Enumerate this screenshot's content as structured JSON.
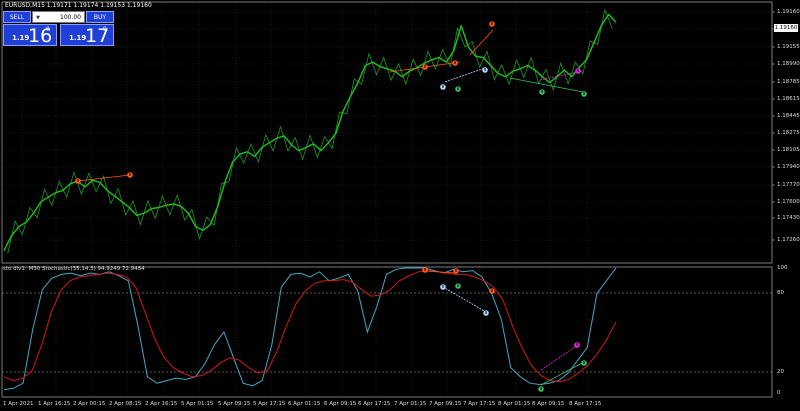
{
  "symbol_line": "EURUSD,M15  1.19171 1.19174 1.19153 1.19160",
  "trade_panel": {
    "sell_label": "SELL",
    "buy_label": "BUY",
    "lot_value": "100.00",
    "lot_arrow": "▼",
    "sell_price_small": "1.19",
    "sell_price_big": "16",
    "sell_price_sup": "0",
    "buy_price_small": "1.19",
    "buy_price_big": "17",
    "buy_price_sup": "9"
  },
  "indicator_title": "sto div1: M30 Stochastic(35,14,3) 94.9249 72.9484",
  "price_axis": [
    "1.19160",
    "1.19325",
    "1.19155",
    "1.18990",
    "1.18785",
    "1.18615",
    "1.18445",
    "1.18275",
    "1.18105",
    "1.17940",
    "1.17770",
    "1.17600",
    "1.17430",
    "1.17260"
  ],
  "current_price": "1.19160",
  "indicator_axis": [
    "100",
    "80",
    "20",
    "0"
  ],
  "time_axis": [
    "1 Apr 2021",
    "1 Apr 16:15",
    "2 Apr 00:15",
    "2 Apr 08:15",
    "2 Apr 16:15",
    "5 Apr 01:15",
    "5 Apr 09:15",
    "5 Apr 17:15",
    "6 Apr 01:15",
    "6 Apr 09:15",
    "6 Apr 17:15",
    "7 Apr 01:15",
    "7 Apr 09:15",
    "7 Apr 17:15",
    "8 Apr 01:15",
    "8 Apr 09:15",
    "8 Apr 17:15"
  ],
  "colors": {
    "background": "#000000",
    "grid": "#34343a",
    "frame": "#b0b0b0",
    "price_line": "#20c020",
    "main_line": "#43a8c8",
    "signal_line": "#d01818",
    "level_line": "#b0b0b0",
    "marker_orange": "#ff5a1a",
    "marker_green": "#3ac060",
    "marker_blue": "#b0d8ff",
    "marker_magenta": "#e028d8"
  },
  "chart_data": [
    {
      "type": "line",
      "series": [
        {
          "values": [
            1.1727,
            1.174,
            1.1748,
            1.1752,
            1.176,
            1.177,
            1.1774,
            1.1778,
            1.178,
            1.1786,
            1.1788,
            1.1783,
            1.1789,
            1.1787,
            1.178,
            1.1775,
            1.177,
            1.1765,
            1.1758,
            1.176,
            1.1764,
            1.1765,
            1.1767,
            1.1768,
            1.1766,
            1.176,
            1.1748,
            1.1745,
            1.175,
            1.1766,
            1.1788,
            1.1805,
            1.1812,
            1.1814,
            1.181,
            1.1818,
            1.1822,
            1.1826,
            1.1828,
            1.182,
            1.1815,
            1.1818,
            1.1821,
            1.1815,
            1.1822,
            1.183,
            1.185,
            1.1863,
            1.1875,
            1.189,
            1.1893,
            1.1889,
            1.1887,
            1.1885,
            1.188,
            1.1885,
            1.1888,
            1.1892,
            1.1895,
            1.1897,
            1.1893,
            1.1903,
            1.1925,
            1.1906,
            1.1898,
            1.1897,
            1.189,
            1.1883,
            1.188,
            1.1885,
            1.1887,
            1.189,
            1.1886,
            1.188,
            1.1875,
            1.188,
            1.1886,
            1.188,
            1.1888,
            1.1895,
            1.191,
            1.1925,
            1.1935,
            1.1928
          ]
        }
      ],
      "ylim": [
        1.1717,
        1.1945
      ]
    },
    {
      "type": "line",
      "series": [
        {
          "values": [
            5,
            6,
            10,
            52,
            83,
            92,
            95,
            96,
            94,
            96,
            95,
            97,
            94,
            90,
            55,
            15,
            10,
            12,
            14,
            13,
            15,
            25,
            40,
            50,
            30,
            10,
            8,
            12,
            40,
            85,
            95,
            96,
            93,
            97,
            90,
            92,
            95,
            82,
            50,
            70,
            95,
            99,
            100,
            100,
            100,
            98,
            96,
            99,
            97,
            98,
            93,
            80,
            60,
            22,
            15,
            10,
            9,
            10,
            12,
            18,
            28,
            38,
            80,
            90,
            100
          ]
        },
        {
          "values": [
            15,
            12,
            14,
            20,
            40,
            65,
            82,
            90,
            93,
            94,
            95,
            96,
            95,
            93,
            85,
            65,
            45,
            30,
            22,
            18,
            15,
            16,
            20,
            26,
            30,
            28,
            22,
            18,
            20,
            35,
            55,
            72,
            82,
            88,
            90,
            90,
            91,
            89,
            83,
            78,
            79,
            83,
            90,
            94,
            97,
            98,
            97,
            96,
            95,
            95,
            93,
            90,
            85,
            75,
            55,
            38,
            24,
            16,
            12,
            11,
            13,
            18,
            24,
            33,
            44,
            58
          ]
        }
      ],
      "ylim": [
        0,
        100
      ]
    }
  ]
}
